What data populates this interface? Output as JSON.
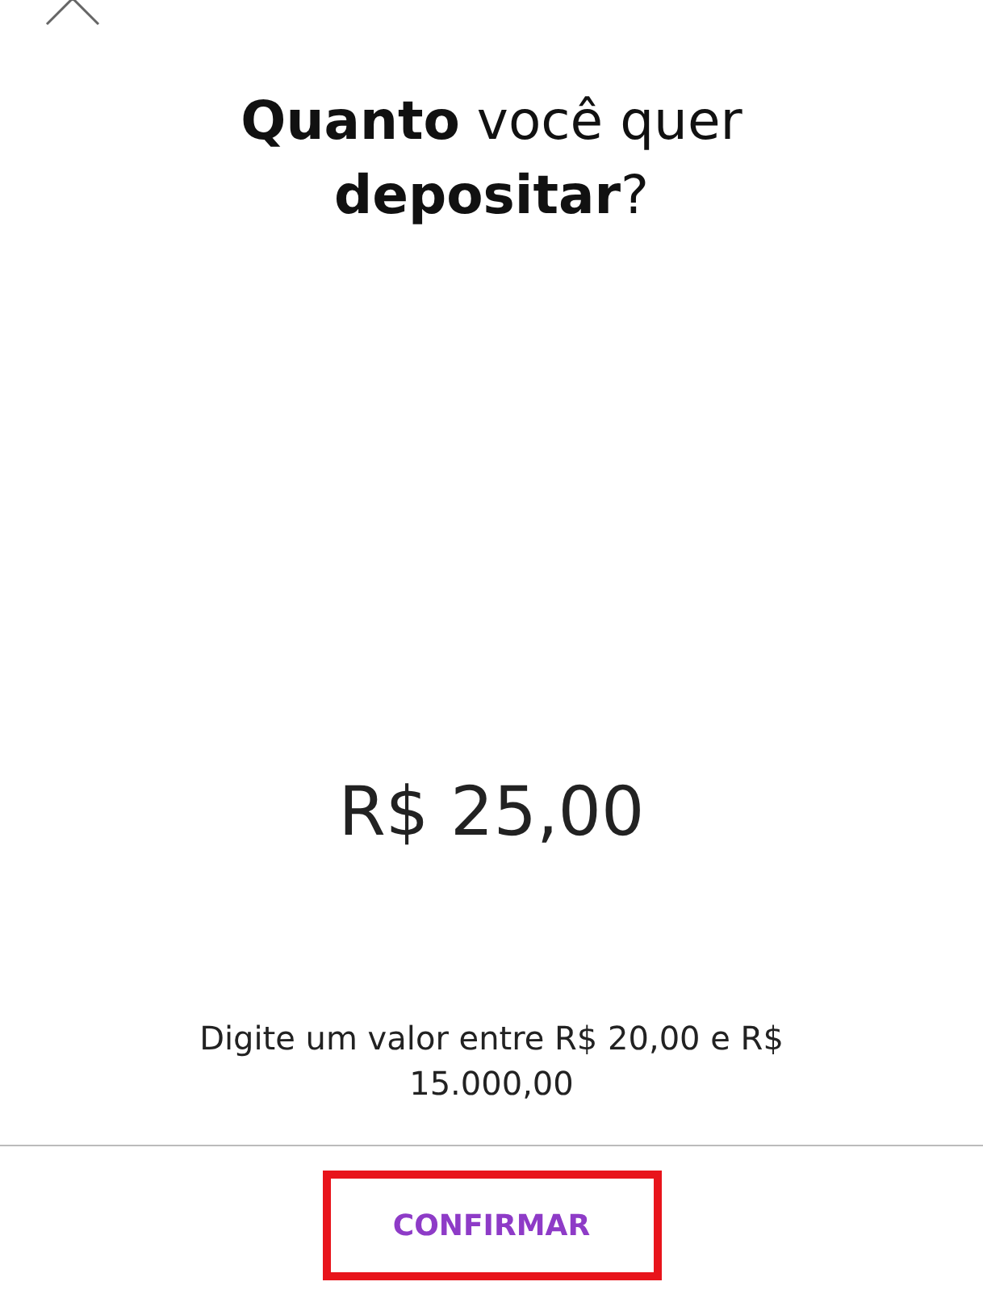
{
  "title": "**Quanto** você quer **depositar**?",
  "amount": {
    "value": "R$ 25,00"
  },
  "hint": "Digite um valor entre R$ 20,00 e R$ 15.000,00",
  "confirm_button": {
    "label": "CONFIRMAR",
    "highlighted": true
  }
}
